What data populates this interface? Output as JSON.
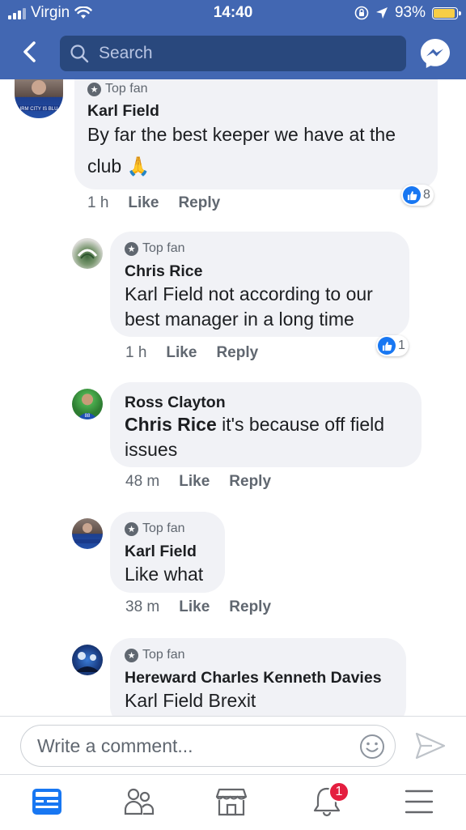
{
  "status_bar": {
    "carrier": "Virgin",
    "time": "14:40",
    "battery": "93%",
    "battery_level": 0.93
  },
  "nav": {
    "back_icon": "chevron-left-icon",
    "search_placeholder": "Search",
    "messenger_icon": "messenger-icon"
  },
  "colors": {
    "brand": "#4267b2",
    "like_blue": "#1877f2",
    "badge_red": "#e41e3f",
    "bubble_bg": "#f1f2f6"
  },
  "comments": [
    {
      "badge": "Top fan",
      "author": "Karl Field",
      "text_line1": "By far the best keeper we have at the",
      "text_line2": "club 🙏",
      "time": "1 h",
      "like": "Like",
      "reply": "Reply",
      "reaction_count": "8"
    },
    {
      "badge": "Top fan",
      "author": "Chris Rice",
      "text_line1": "Karl Field not according to our",
      "text_line2": "best manager in a long time",
      "time": "1 h",
      "like": "Like",
      "reply": "Reply",
      "reaction_count": "1"
    },
    {
      "author": "Ross Clayton",
      "mention": "Chris Rice",
      "text_line1": " it's because off field",
      "text_line2": "issues",
      "time": "48 m",
      "like": "Like",
      "reply": "Reply"
    },
    {
      "badge": "Top fan",
      "author": "Karl Field",
      "text_line1": "Like what",
      "time": "38 m",
      "like": "Like",
      "reply": "Reply"
    },
    {
      "badge": "Top fan",
      "author": "Hereward Charles Kenneth Davies",
      "text_line1": "Karl Field Brexit"
    }
  ],
  "composer": {
    "placeholder": "Write a comment...",
    "emoji_icon": "smiley-icon",
    "send_icon": "send-icon"
  },
  "tabbar": {
    "tabs": [
      "news-feed-icon",
      "friends-icon",
      "marketplace-icon",
      "notifications-icon",
      "menu-icon"
    ],
    "notifications_badge": "1"
  }
}
